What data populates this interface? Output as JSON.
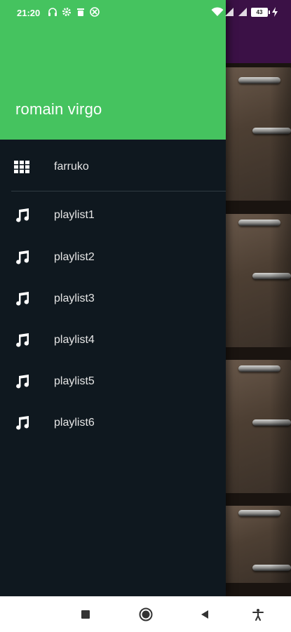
{
  "status_bar": {
    "time": "21:20",
    "battery": "43",
    "icons_left": [
      "headset-icon",
      "settings-icon",
      "trash-icon",
      "vpn-icon"
    ],
    "icons_right": [
      "wifi-icon",
      "signal-icon",
      "signal-icon",
      "battery-icon",
      "charging-icon"
    ]
  },
  "drawer": {
    "header_color": "#45c35f",
    "background_color": "#0f181f",
    "username": "romain virgo",
    "items": [
      {
        "label": "farruko",
        "icon": "grid-icon"
      },
      {
        "label": "playlist1",
        "icon": "music-note-icon"
      },
      {
        "label": "playlist2",
        "icon": "music-note-icon"
      },
      {
        "label": "playlist3",
        "icon": "music-note-icon"
      },
      {
        "label": "playlist4",
        "icon": "music-note-icon"
      },
      {
        "label": "playlist5",
        "icon": "music-note-icon"
      },
      {
        "label": "playlist6",
        "icon": "music-note-icon"
      }
    ]
  },
  "nav_bar": {
    "buttons": [
      "recents-icon",
      "home-icon",
      "back-icon",
      "accessibility-icon"
    ]
  }
}
